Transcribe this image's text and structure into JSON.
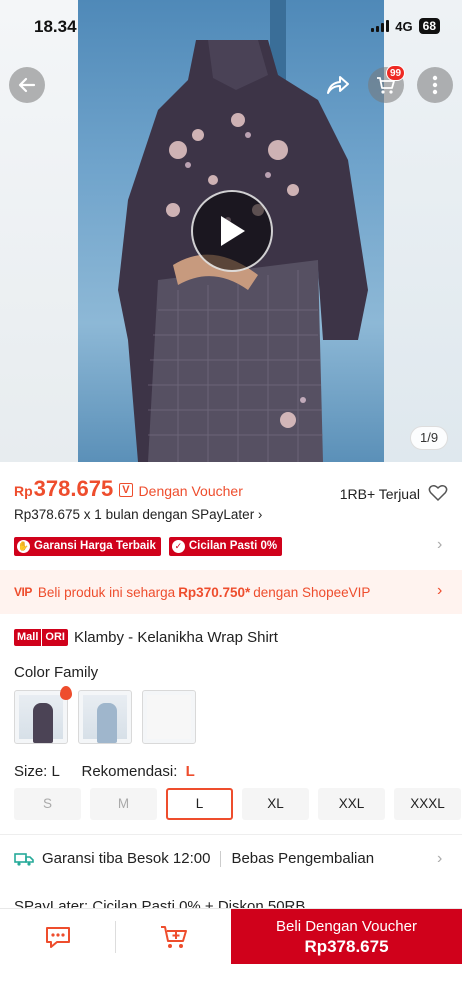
{
  "status_bar": {
    "time": "18.34",
    "network": "4G",
    "battery": "68"
  },
  "header": {
    "cart_count": "99",
    "image_counter": "1/9"
  },
  "price": {
    "currency": "Rp",
    "value": "378.675",
    "voucher_icon": "V",
    "note": "Dengan Voucher",
    "sold": "1RB+ Terjual",
    "spaylater": "Rp378.675 x 1 bulan dengan SPayLater ›"
  },
  "badges": [
    {
      "label": "Garansi Harga Terbaik",
      "icon": "hand-icon"
    },
    {
      "label": "Cicilan Pasti 0%",
      "icon": "check-icon"
    }
  ],
  "vip": {
    "tag": "VIP",
    "prefix": "Beli produk ini seharga",
    "price": "Rp370.750*",
    "suffix": "dengan ShopeeVIP"
  },
  "product": {
    "mall_label": "Mall",
    "ori_label": "ORI",
    "title": "Klamby - Kelanikha Wrap Shirt"
  },
  "variation": {
    "label": "Color Family",
    "size_label": "Size:",
    "size_selected": "L",
    "recommend_label": "Rekomendasi:",
    "recommend_value": "L",
    "sizes": [
      "S",
      "M",
      "L",
      "XL",
      "XXL",
      "XXXL"
    ]
  },
  "shipping": {
    "label": "Garansi tiba Besok 12:00",
    "returns": "Bebas Pengembalian"
  },
  "spaylater_row": "SPayLater: Cicilan Pasti 0% + Diskon 50RB",
  "bottom_bar": {
    "buy_line1": "Beli Dengan Voucher",
    "buy_line2": "Rp378.675"
  },
  "colors": {
    "accent": "#ee4d2d",
    "mall_red": "#d0011b"
  }
}
